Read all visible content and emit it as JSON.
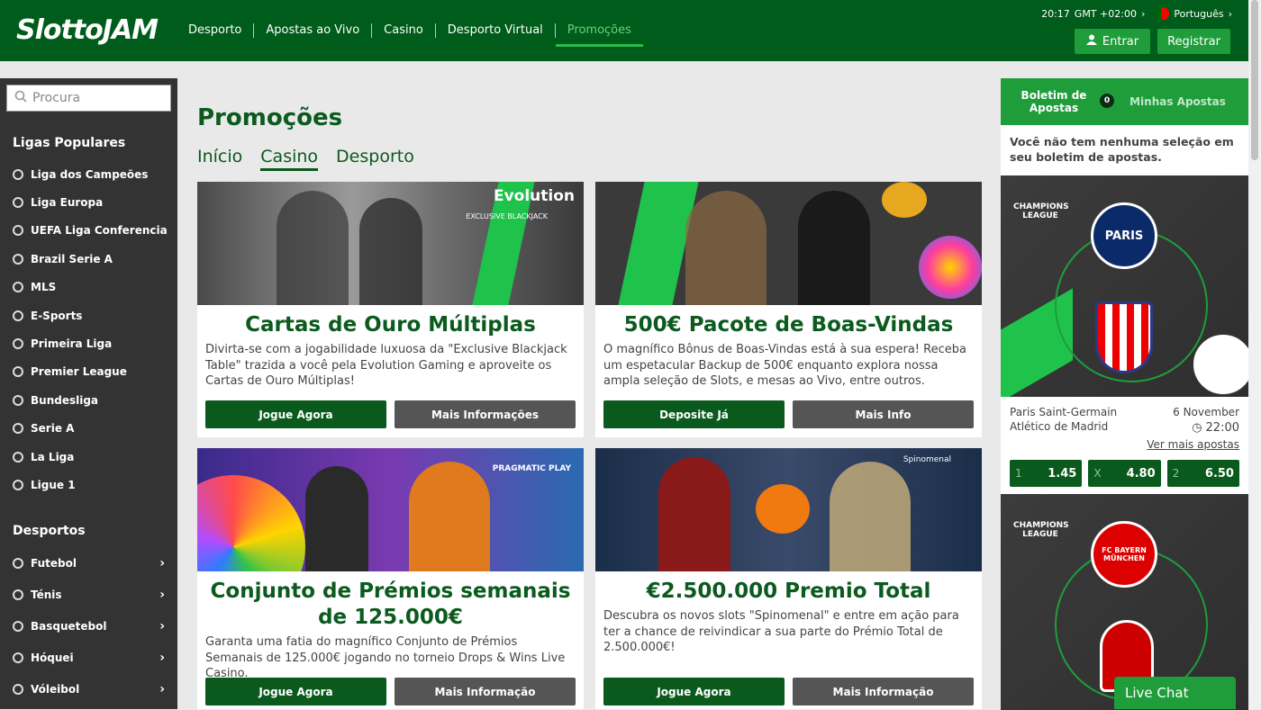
{
  "header": {
    "logo": "SlottoJAM",
    "nav": [
      "Desporto",
      "Apostas ao Vivo",
      "Casino",
      "Desporto Virtual",
      "Promoções"
    ],
    "active_nav": "Promoções",
    "time": "20:17",
    "timezone": "GMT +02:00",
    "language": "Português",
    "login_label": "Entrar",
    "register_label": "Registrar"
  },
  "sidebar": {
    "search_placeholder": "Procura",
    "popular_title": "Ligas Populares",
    "popular": [
      "Liga dos Campeões",
      "Liga Europa",
      "UEFA Liga Conferencia",
      "Brazil Serie A",
      "MLS",
      "E-Sports",
      "Primeira Liga",
      "Premier League",
      "Bundesliga",
      "Serie A",
      "La Liga",
      "Ligue 1"
    ],
    "sports_title": "Desportos",
    "sports": [
      "Futebol",
      "Ténis",
      "Basquetebol",
      "Hóquei",
      "Vóleibol"
    ]
  },
  "main": {
    "title": "Promoções",
    "tabs": [
      "Início",
      "Casino",
      "Desporto"
    ],
    "active_tab": "Casino",
    "cards": [
      {
        "title": "Cartas de Ouro Múltiplas",
        "desc": "Divirta-se com a jogabilidade luxuosa da \"Exclusive Blackjack Table\" trazida a você pela Evolution Gaming e aproveite os Cartas de Ouro Múltiplas!",
        "btn1": "Jogue Agora",
        "btn2": "Mais Informações",
        "brand": "Evolution",
        "sub": "EXCLUSIVE BLACKJACK"
      },
      {
        "title": "500€ Pacote de Boas-Vindas",
        "desc": "O magnífico Bônus de Boas-Vindas está à sua espera! Receba um espetacular Backup de 500€ enquanto explora nossa ampla seleção de Slots, e mesas ao Vivo, entre outros.",
        "btn1": "Deposite Já",
        "btn2": "Mais Info"
      },
      {
        "title": "Conjunto de Prémios semanais de 125.000€",
        "desc": "Garanta uma fatia do magnífico Conjunto de Prémios Semanais de 125.000€ jogando no torneio Drops & Wins Live Casino.",
        "btn1": "Jogue Agora",
        "btn2": "Mais Informação",
        "brand": "PRAGMATIC PLAY"
      },
      {
        "title": "€2.500.000 Premio Total",
        "desc": "Descubra os novos slots \"Spinomenal\" e entre em ação para ter a chance de reivindicar a sua parte do Prémio Total de 2.500.000€!",
        "btn1": "Jogue Agora",
        "btn2": "Mais Informação",
        "brand": "Spinomenal"
      }
    ]
  },
  "betslip": {
    "tab1": "Boletim de Apostas",
    "count": "0",
    "tab2": "Minhas Apostas",
    "empty": "Você não tem nenhuma seleção em seu boletim de apostas.",
    "league_label": "CHAMPIONS LEAGUE",
    "team1_badge": "PARIS",
    "team3_badge": "FC BAYERN MÜNCHEN",
    "match": {
      "home": "Paris Saint-Germain",
      "away": "Atlético de Madrid",
      "date": "6 November",
      "time": "22:00",
      "more": "Ver mais apostas",
      "odds": [
        {
          "k": "1",
          "v": "1.45"
        },
        {
          "k": "X",
          "v": "4.80"
        },
        {
          "k": "2",
          "v": "6.50"
        }
      ]
    }
  },
  "livechat": "Live Chat"
}
